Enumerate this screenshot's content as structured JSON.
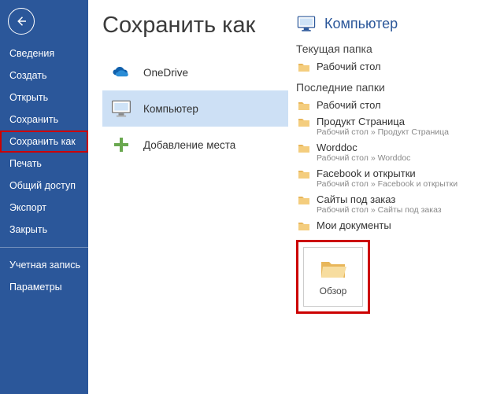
{
  "sidebar": {
    "items": [
      {
        "label": "Сведения"
      },
      {
        "label": "Создать"
      },
      {
        "label": "Открыть"
      },
      {
        "label": "Сохранить"
      },
      {
        "label": "Сохранить как",
        "selected": true
      },
      {
        "label": "Печать"
      },
      {
        "label": "Общий доступ"
      },
      {
        "label": "Экспорт"
      },
      {
        "label": "Закрыть"
      }
    ],
    "footer": [
      {
        "label": "Учетная запись"
      },
      {
        "label": "Параметры"
      }
    ]
  },
  "page": {
    "title": "Сохранить как"
  },
  "places": [
    {
      "label": "OneDrive",
      "icon": "onedrive"
    },
    {
      "label": "Компьютер",
      "icon": "computer",
      "selected": true
    },
    {
      "label": "Добавление места",
      "icon": "add"
    }
  ],
  "right": {
    "header": "Компьютер",
    "current_label": "Текущая папка",
    "current_folder": {
      "name": "Рабочий стол"
    },
    "recent_label": "Последние папки",
    "recent": [
      {
        "name": "Рабочий стол"
      },
      {
        "name": "Продукт Страница",
        "path": "Рабочий стол » Продукт Страница"
      },
      {
        "name": "Worddoc",
        "path": "Рабочий стол » Worddoc"
      },
      {
        "name": "Facebook и открытки",
        "path": "Рабочий стол » Facebook и открытки"
      },
      {
        "name": "Сайты под заказ",
        "path": "Рабочий стол » Сайты под заказ"
      },
      {
        "name": "Мои документы"
      }
    ],
    "browse_label": "Обзор"
  },
  "colors": {
    "accent": "#2b579a",
    "highlight": "#cc0000"
  }
}
